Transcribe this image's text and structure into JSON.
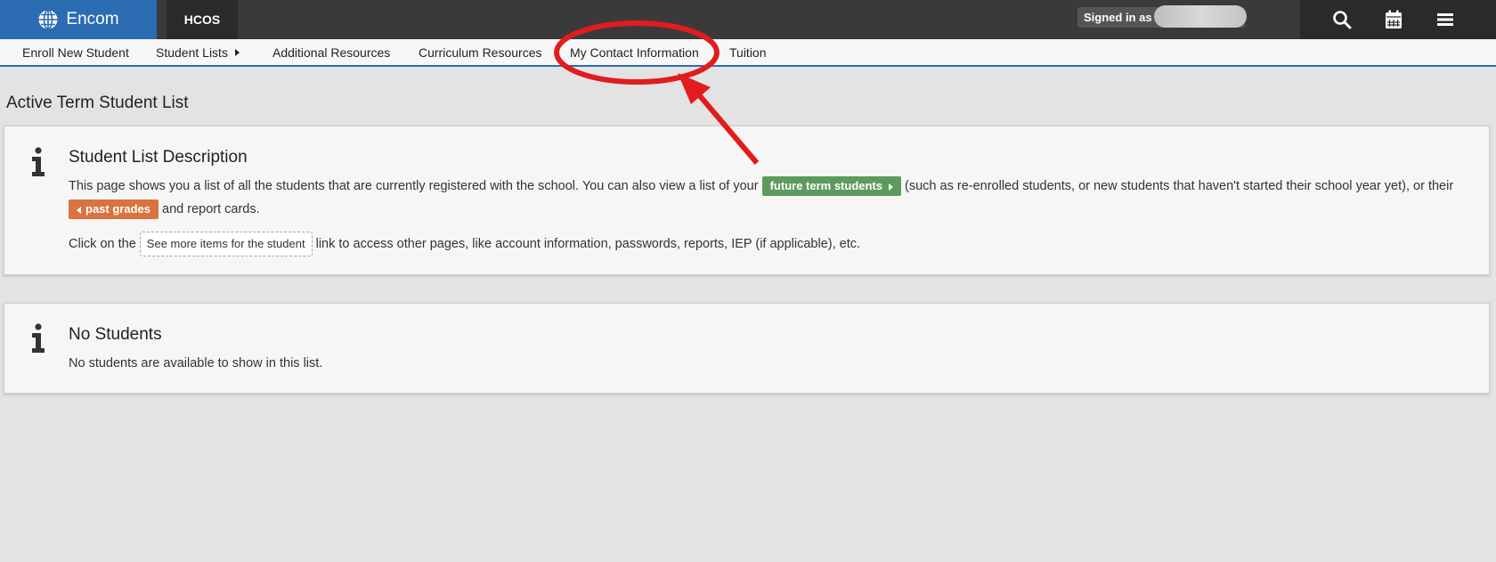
{
  "topbar": {
    "brand": "Encom",
    "school": "HCOS",
    "signed_in_label": "Signed in as"
  },
  "nav": {
    "items": [
      {
        "label": "Enroll New Student"
      },
      {
        "label": "Student Lists"
      },
      {
        "label": "Additional Resources"
      },
      {
        "label": "Curriculum Resources"
      },
      {
        "label": "My Contact Information"
      },
      {
        "label": "Tuition"
      }
    ]
  },
  "page": {
    "title": "Active Term Student List"
  },
  "description_card": {
    "title": "Student List Description",
    "text1": "This page shows you a list of all the students that are currently registered with the school. You can also view a list of your",
    "future_button": "future term students",
    "text2": "(such as re-enrolled students, or new students that haven't started their school",
    "text3": "year yet), or their",
    "past_button": "past grades",
    "text4": "and report cards.",
    "text5": "Click on the",
    "more_button": "See more items for the student",
    "text6": "link to access other pages, like account information, passwords, reports, IEP (if applicable), etc."
  },
  "empty_card": {
    "title": "No Students",
    "text": "No students are available to show in this list."
  },
  "colors": {
    "brand_blue": "#2b6cb3",
    "topbar": "#3a3a3a",
    "green_button": "#5e9a5d",
    "orange_button": "#d9733f",
    "annotation_red": "#e11c1c"
  },
  "icons": [
    "globe-icon",
    "search-icon",
    "calendar-icon",
    "menu-icon",
    "info-icon",
    "caret-right-icon"
  ]
}
